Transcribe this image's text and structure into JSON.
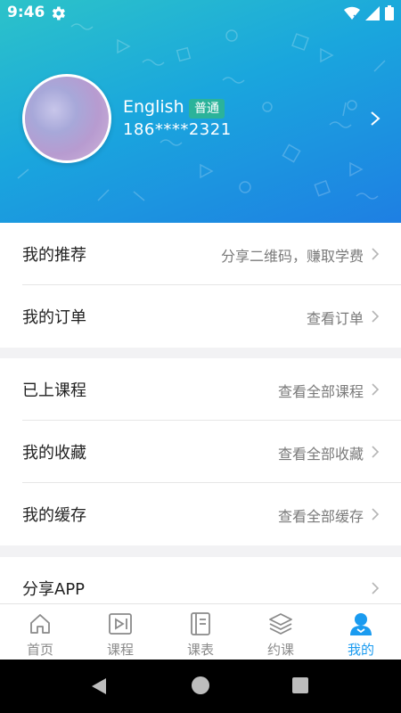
{
  "status_bar": {
    "time": "9:46"
  },
  "profile": {
    "name": "English",
    "level_badge": "普通",
    "phone": "186****2321"
  },
  "menu_groups": [
    [
      {
        "label": "我的推荐",
        "hint": "分享二维码，赚取学费"
      },
      {
        "label": "我的订单",
        "hint": "查看订单"
      }
    ],
    [
      {
        "label": "已上课程",
        "hint": "查看全部课程"
      },
      {
        "label": "我的收藏",
        "hint": "查看全部收藏"
      },
      {
        "label": "我的缓存",
        "hint": "查看全部缓存"
      }
    ],
    [
      {
        "label": "分享APP",
        "hint": ""
      }
    ]
  ],
  "tabbar": {
    "items": [
      {
        "label": "首页",
        "icon": "home-icon"
      },
      {
        "label": "课程",
        "icon": "video-play-icon"
      },
      {
        "label": "课表",
        "icon": "notebook-icon"
      },
      {
        "label": "约课",
        "icon": "layers-icon"
      },
      {
        "label": "我的",
        "icon": "person-icon",
        "active": true
      }
    ]
  },
  "colors": {
    "accent": "#1a9bf0",
    "header_start": "#2cc3c9",
    "header_end": "#1e7fe3",
    "badge": "#2bb39a"
  }
}
